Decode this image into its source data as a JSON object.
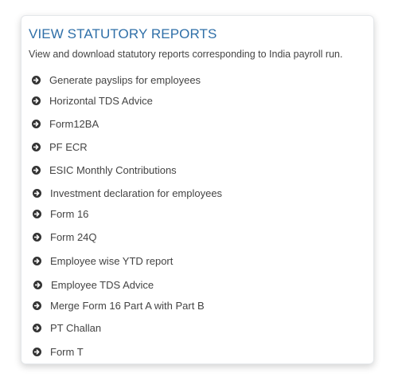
{
  "card": {
    "title": "VIEW STATUTORY REPORTS",
    "description": "View and download statutory reports corresponding to India payroll run.",
    "item_icon": "circle-arrow-right-icon",
    "items": [
      {
        "label": "Generate payslips for employees"
      },
      {
        "label": "Horizontal TDS Advice"
      },
      {
        "label": "Form12BA"
      },
      {
        "label": "PF ECR"
      },
      {
        "label": "ESIC Monthly Contributions"
      },
      {
        "label": "Investment declaration for employees"
      },
      {
        "label": "Form 16"
      },
      {
        "label": "Form 24Q"
      },
      {
        "label": "Employee wise YTD report"
      },
      {
        "label": "Employee TDS Advice"
      },
      {
        "label": "Merge Form 16 Part A with Part B"
      },
      {
        "label": "PT Challan"
      },
      {
        "label": "Form T"
      }
    ]
  },
  "colors": {
    "title": "#2f6fa8",
    "text": "#444444",
    "icon": "#333333"
  }
}
